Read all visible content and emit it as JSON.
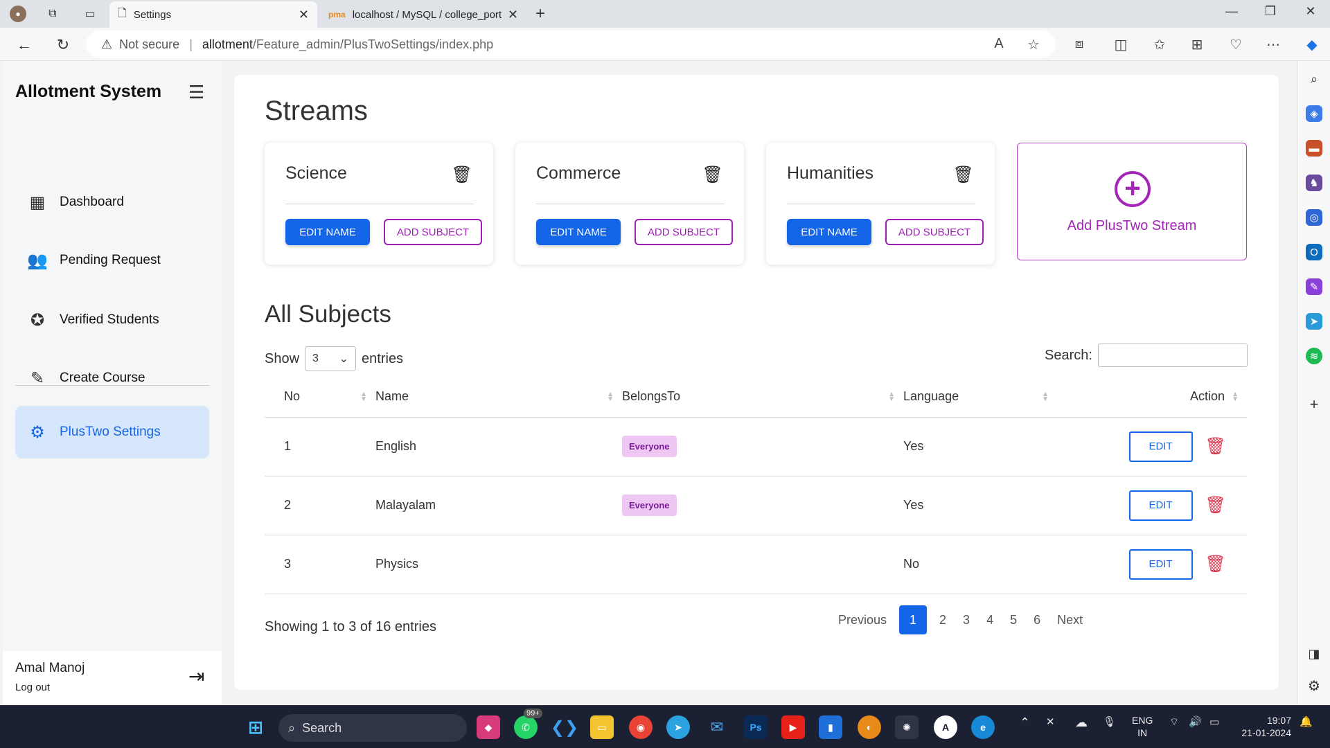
{
  "browser": {
    "tabs": [
      {
        "title": "Settings",
        "active": true
      },
      {
        "title": "localhost / MySQL / college_port",
        "active": false
      }
    ],
    "security_label": "Not secure",
    "url_host": "allotment",
    "url_path": "/Feature_admin/PlusTwoSettings/index.php"
  },
  "sidebar": {
    "brand": "Allotment System",
    "items": [
      {
        "label": "Dashboard",
        "icon": "grid-icon"
      },
      {
        "label": "Pending Request",
        "icon": "users-icon"
      },
      {
        "label": "Verified Students",
        "icon": "verified-badge-icon"
      },
      {
        "label": "Create Course",
        "icon": "edit-document-icon"
      },
      {
        "label": "PlusTwo Settings",
        "icon": "gear-icon",
        "active": true
      }
    ],
    "user_name": "Amal Manoj",
    "logout_label": "Log out"
  },
  "streams": {
    "heading": "Streams",
    "cards": [
      {
        "name": "Science",
        "edit_label": "EDIT NAME",
        "add_label": "ADD SUBJECT"
      },
      {
        "name": "Commerce",
        "edit_label": "EDIT NAME",
        "add_label": "ADD SUBJECT"
      },
      {
        "name": "Humanities",
        "edit_label": "EDIT NAME",
        "add_label": "ADD SUBJECT"
      }
    ],
    "add_stream_label": "Add PlusTwo Stream"
  },
  "subjects": {
    "heading": "All Subjects",
    "show_label": "Show",
    "entries_value": "3",
    "entries_label": "entries",
    "search_label": "Search:",
    "columns": [
      "No",
      "Name",
      "BelongsTo",
      "Language",
      "Action"
    ],
    "rows": [
      {
        "no": "1",
        "name": "English",
        "belongs": "Everyone",
        "language": "Yes",
        "edit": "EDIT"
      },
      {
        "no": "2",
        "name": "Malayalam",
        "belongs": "Everyone",
        "language": "Yes",
        "edit": "EDIT"
      },
      {
        "no": "3",
        "name": "Physics",
        "belongs": "",
        "language": "No",
        "edit": "EDIT"
      }
    ],
    "info": "Showing 1 to 3 of 16 entries",
    "pager": {
      "previous": "Previous",
      "pages": [
        "1",
        "2",
        "3",
        "4",
        "5",
        "6"
      ],
      "current": "1",
      "next": "Next"
    }
  },
  "taskbar": {
    "search_label": "Search",
    "whatsapp_badge": "99+",
    "lang_top": "ENG",
    "lang_bottom": "IN",
    "time": "19:07",
    "date": "21-01-2024"
  },
  "colors": {
    "primary": "#1565e8",
    "accent": "#a326b8",
    "danger": "#e0304a"
  }
}
